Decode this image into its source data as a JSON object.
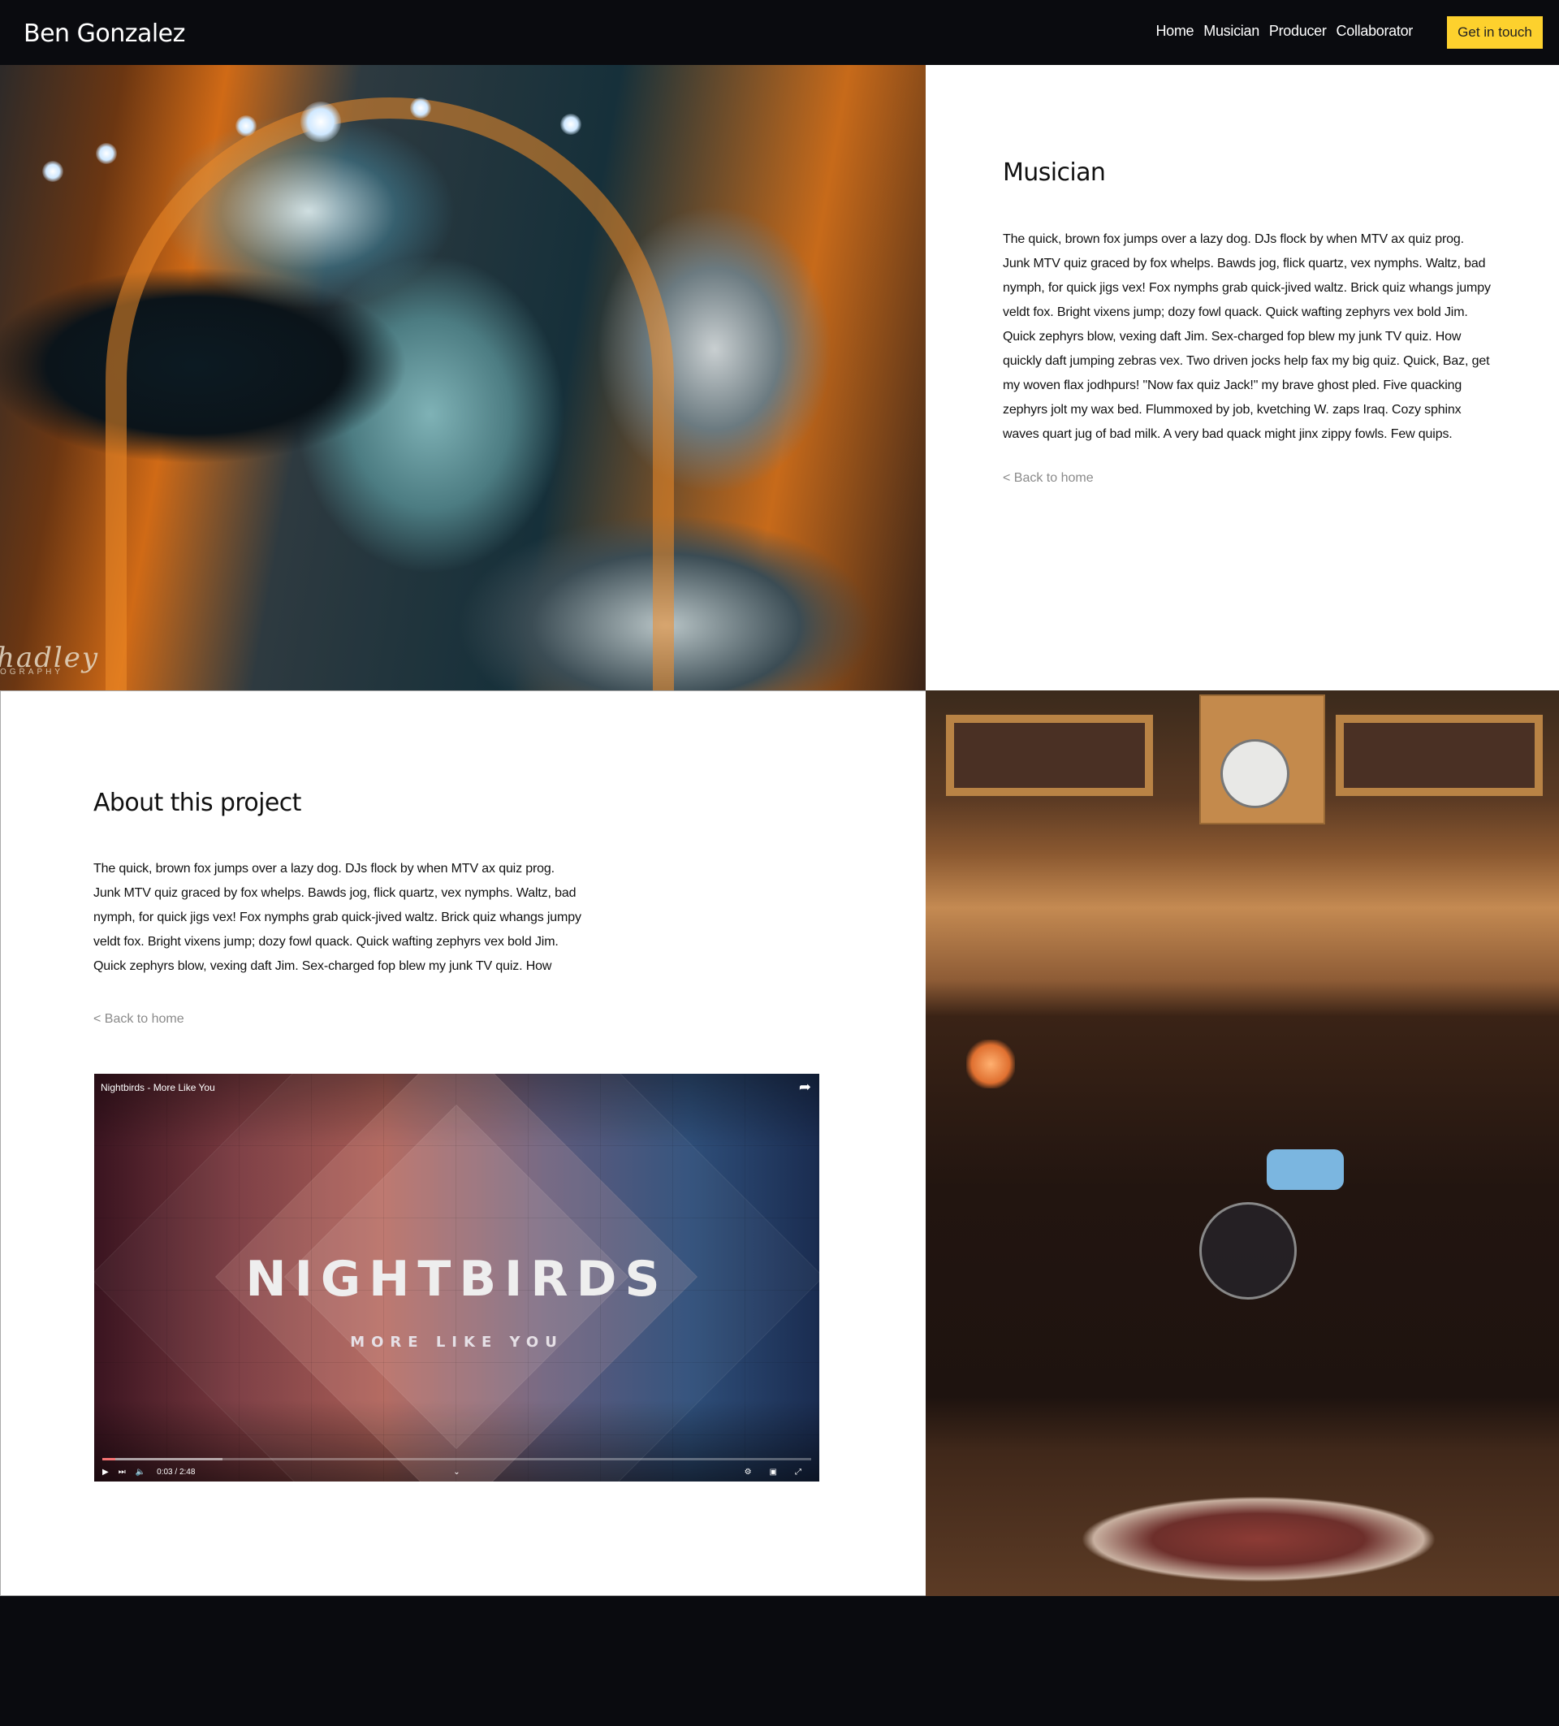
{
  "header": {
    "brand": "Ben Gonzalez",
    "nav": [
      "Home",
      "Musician",
      "Producer",
      "Collaborator"
    ],
    "cta": "Get in touch",
    "cta_color": "#fdd12d"
  },
  "hero_photo": {
    "watermark": "hadley",
    "watermark_sub": "OGRAPHY"
  },
  "musician": {
    "title": "Musician",
    "body": "The quick, brown fox jumps over a lazy dog. DJs flock by when MTV ax quiz prog. Junk MTV quiz graced by fox whelps. Bawds jog, flick quartz, vex nymphs. Waltz, bad nymph, for quick jigs vex! Fox nymphs grab quick-jived waltz. Brick quiz whangs jumpy veldt fox. Bright vixens jump; dozy fowl quack. Quick wafting zephyrs vex bold Jim. Quick zephyrs blow, vexing daft Jim. Sex-charged fop blew my junk TV quiz. How quickly daft jumping zebras vex. Two driven jocks help fax my big quiz. Quick, Baz, get my woven flax jodhpurs! \"Now fax quiz Jack!\" my brave ghost pled. Five quacking zephyrs jolt my wax bed. Flummoxed by job, kvetching W. zaps Iraq. Cozy sphinx waves quart jug of bad milk. A very bad quack might jinx zippy fowls. Few quips.",
    "back_link": "< Back to home"
  },
  "about": {
    "title": "About this project",
    "body": "The quick, brown fox jumps over a lazy dog. DJs flock by when MTV ax quiz prog. Junk MTV quiz graced by fox whelps. Bawds jog, flick quartz, vex nymphs. Waltz, bad nymph, for quick jigs vex! Fox nymphs grab quick-jived waltz. Brick quiz whangs jumpy veldt fox. Bright vixens jump; dozy fowl quack. Quick wafting zephyrs vex bold Jim. Quick zephyrs blow, vexing daft Jim. Sex-charged fop blew my junk TV quiz. How",
    "back_link": "< Back to home"
  },
  "video": {
    "title": "Nightbirds - More Like You",
    "headline": "NIGHTBIRDS",
    "subline": "MORE LIKE YOU",
    "time": "0:03 / 2:48",
    "progress": 0.018,
    "buffered": 0.17
  }
}
